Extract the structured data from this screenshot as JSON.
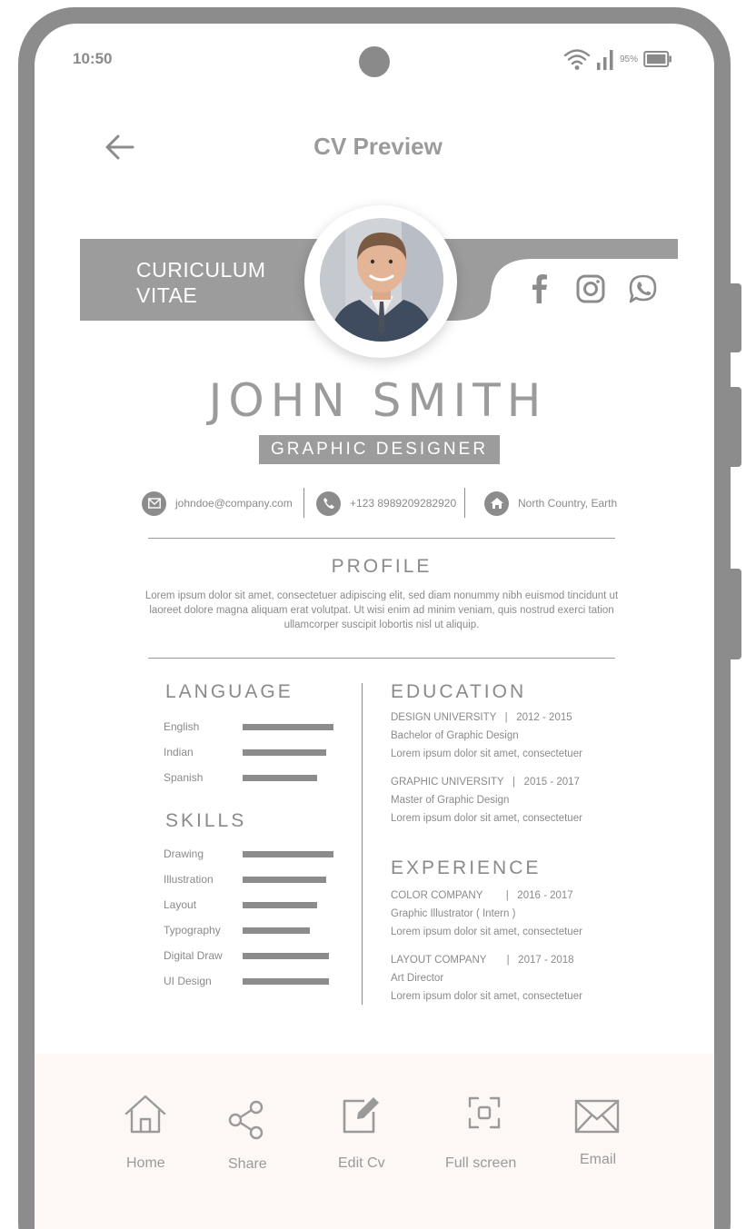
{
  "status_bar": {
    "time": "10:50",
    "battery": "95%"
  },
  "header": {
    "title": "CV Preview"
  },
  "cv": {
    "banner_title_line1": "CURICULUM",
    "banner_title_line2": "VITAE",
    "name": "JOHN SMITH",
    "role": "GRAPHIC DESIGNER",
    "contact": {
      "email": "johndoe@company.com",
      "phone": "+123 8989209282920",
      "address": "North Country, Earth"
    },
    "profile": {
      "heading": "PROFILE",
      "text": "Lorem ipsum dolor sit amet, consectetuer adipiscing elit, sed diam nonummy nibh euismod tincidunt ut laoreet dolore magna aliquam erat volutpat. Ut wisi enim ad minim veniam, quis nostrud exerci tation ullamcorper suscipit lobortis nisl ut aliquip."
    },
    "language": {
      "heading": "LANGUAGE",
      "items": [
        {
          "label": "English",
          "level": 1.0
        },
        {
          "label": "Indian",
          "level": 0.92
        },
        {
          "label": "Spanish",
          "level": 0.82
        }
      ]
    },
    "skills": {
      "heading": "SKILLS",
      "items": [
        {
          "label": "Drawing",
          "level": 1.0
        },
        {
          "label": "Illustration",
          "level": 0.92
        },
        {
          "label": "Layout",
          "level": 0.82
        },
        {
          "label": "Typography",
          "level": 0.74
        },
        {
          "label": "Digital Draw",
          "level": 0.95
        },
        {
          "label": "UI Design",
          "level": 0.95
        }
      ]
    },
    "education": {
      "heading": "EDUCATION",
      "items": [
        {
          "title": "DESIGN UNIVERSITY   |   2012 - 2015",
          "degree": "Bachelor of Graphic Design",
          "desc": "Lorem ipsum dolor sit amet, consectetuer"
        },
        {
          "title": "GRAPHIC UNIVERSITY   |   2015 - 2017",
          "degree": "Master of Graphic Design",
          "desc": "Lorem ipsum dolor sit amet, consectetuer"
        }
      ]
    },
    "experience": {
      "heading": "EXPERIENCE",
      "items": [
        {
          "title": "COLOR COMPANY        |   2016 - 2017",
          "degree": "Graphic Illustrator ( Intern )",
          "desc": "Lorem ipsum dolor sit amet, consectetuer"
        },
        {
          "title": "LAYOUT COMPANY       |   2017 - 2018",
          "degree": "Art Director",
          "desc": "Lorem ipsum dolor sit amet, consectetuer"
        }
      ]
    }
  },
  "bottom_nav": [
    {
      "label": "Home",
      "icon": "home-icon"
    },
    {
      "label": "Share",
      "icon": "share-icon"
    },
    {
      "label": "Edit Cv",
      "icon": "edit-icon"
    },
    {
      "label": "Full screen",
      "icon": "fullscreen-icon"
    },
    {
      "label": "Email",
      "icon": "email-icon"
    }
  ],
  "colors": {
    "frame": "#8c8c8c",
    "band": "#9c9c9c",
    "bottom_bar": "#fdf8f5"
  }
}
